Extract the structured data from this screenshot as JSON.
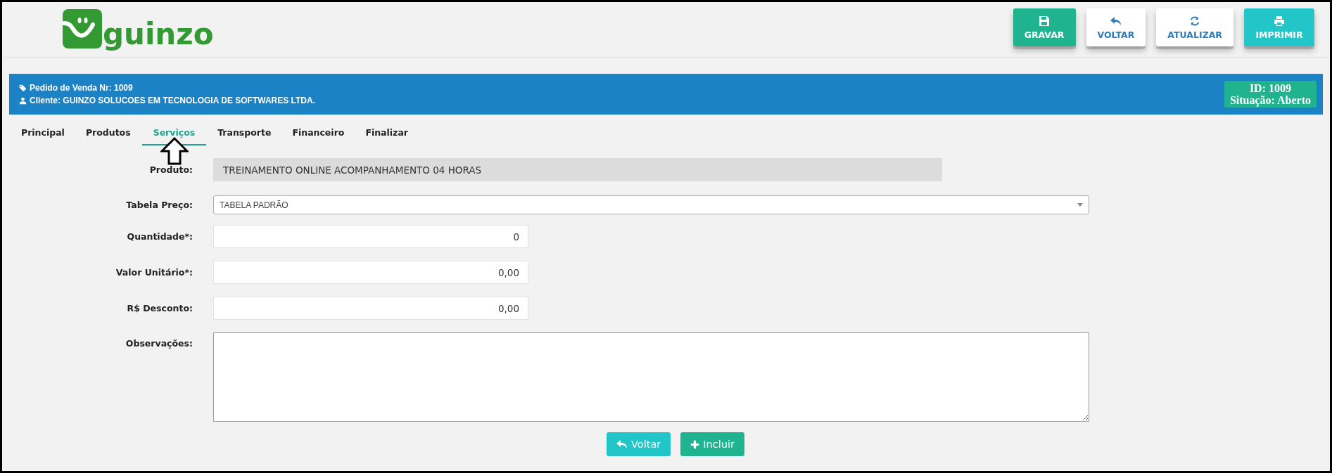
{
  "header": {
    "logo_text": "guinzo",
    "actions": [
      {
        "kind": "save",
        "label": "GRAVAR"
      },
      {
        "kind": "back",
        "label": "VOLTAR"
      },
      {
        "kind": "refresh",
        "label": "ATUALIZAR"
      },
      {
        "kind": "print",
        "label": "IMPRIMIR"
      }
    ]
  },
  "order_bar": {
    "order": "Pedido de Venda Nr: 1009",
    "client": "Cliente: GUINZO SOLUCOES EM TECNOLOGIA DE SOFTWARES LTDA.",
    "id": "ID: 1009",
    "status": "Situação: Aberto"
  },
  "tabs": [
    {
      "label": "Principal",
      "selected": false
    },
    {
      "label": "Produtos",
      "selected": false
    },
    {
      "label": "Serviços",
      "selected": true
    },
    {
      "label": "Transporte",
      "selected": false
    },
    {
      "label": "Financeiro",
      "selected": false
    },
    {
      "label": "Finalizar",
      "selected": false
    }
  ],
  "form": {
    "fields": [
      {
        "kind": "readonly",
        "label": "Produto:",
        "value": "TREINAMENTO ONLINE ACOMPANHAMENTO 04 HORAS"
      },
      {
        "kind": "select",
        "label": "Tabela Preço:",
        "value": "TABELA PADRÃO"
      },
      {
        "kind": "number",
        "label": "Quantidade*:",
        "value": "0"
      },
      {
        "kind": "number",
        "label": "Valor Unitário*:",
        "value": "0,00"
      },
      {
        "kind": "number",
        "label": "R$ Desconto:",
        "value": "0,00"
      },
      {
        "kind": "textarea",
        "label": "Observações:"
      }
    ],
    "buttons": [
      {
        "kind": "back",
        "label": "Voltar"
      },
      {
        "kind": "add",
        "label": "Incluir"
      }
    ]
  }
}
